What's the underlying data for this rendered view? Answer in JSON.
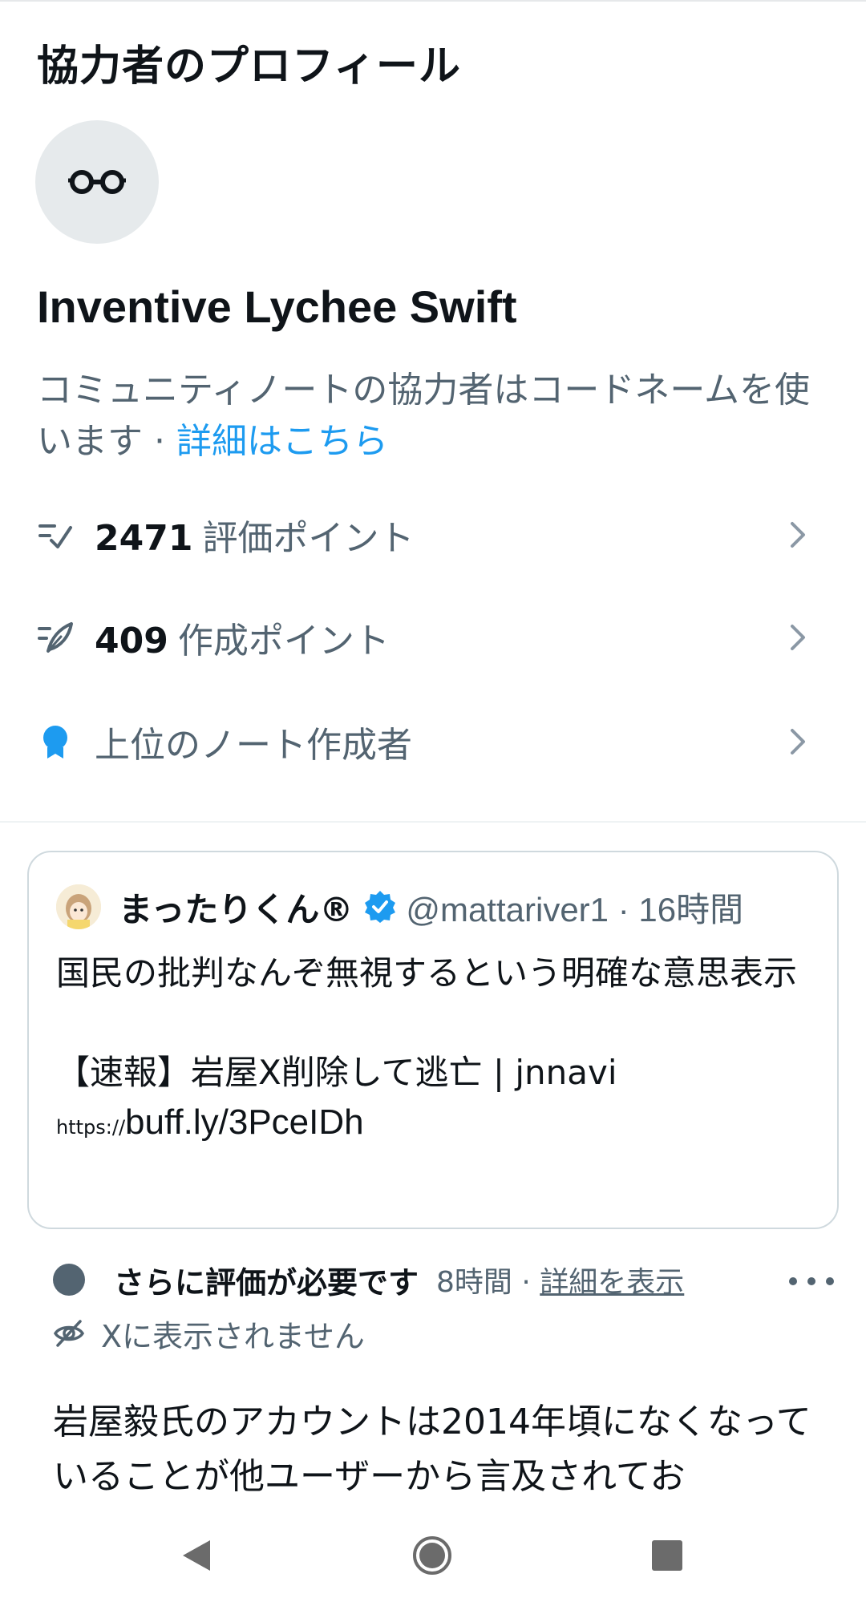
{
  "header": {
    "title": "協力者のプロフィール"
  },
  "profile": {
    "avatar_icon": "glasses-icon",
    "codename": "Inventive Lychee Swift",
    "description": "コミュニティノートの協力者はコードネームを使います · ",
    "learn_more": "詳細はこちら"
  },
  "stats": [
    {
      "icon": "rating-icon",
      "value": "2471",
      "label": "評価ポイント"
    },
    {
      "icon": "writing-icon",
      "value": "409",
      "label": "作成ポイント"
    },
    {
      "icon": "badge-icon",
      "value": "",
      "label": "上位のノート作成者"
    }
  ],
  "tweet": {
    "name": "まったりくん®",
    "handle": "@mattariver1 · 16時間",
    "lines": [
      "国民の批判なんぞ無視するという明確な意思表示",
      "",
      "【速報】岩屋X削除して逃亡 | jnnavi"
    ],
    "url_prefix": "https://",
    "url": "buff.ly/3PceIDh"
  },
  "note": {
    "status": "さらに評価が必要です",
    "time": "8時間 · ",
    "details_link": "詳細を表示",
    "visibility": "Xに表示されません",
    "body": "岩屋毅氏のアカウントは2014年頃になくなっていることが他ユーザーから言及されてお"
  },
  "colors": {
    "accent": "#1d9bf0",
    "text": "#0f1419",
    "secondary": "#536471",
    "status_dot": "#536471"
  },
  "navbar": {
    "icons": [
      "back-icon",
      "home-icon",
      "recents-icon"
    ]
  }
}
